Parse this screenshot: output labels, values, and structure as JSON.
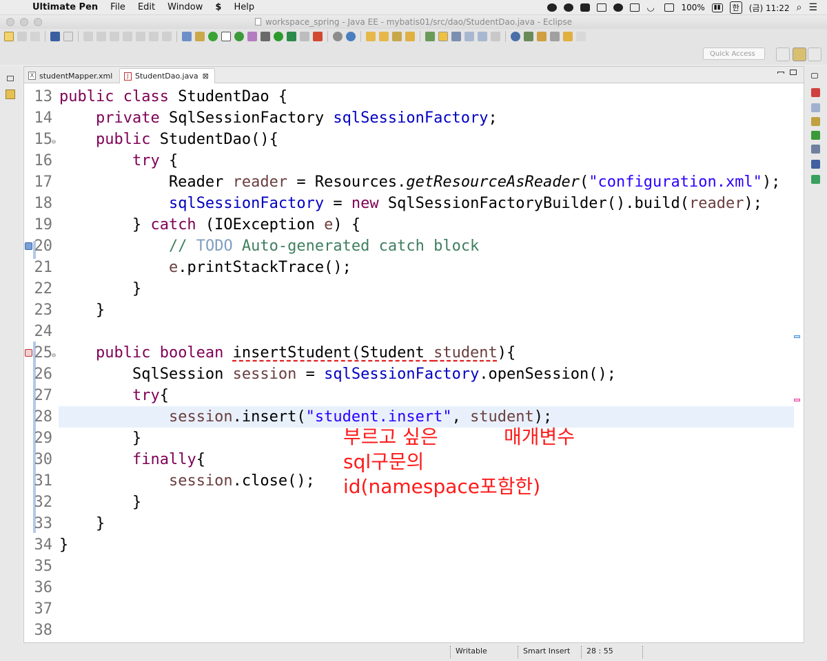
{
  "menubar": {
    "app_name": "Ultimate Pen",
    "items": [
      "File",
      "Edit",
      "Window",
      "Help"
    ],
    "battery": "100%",
    "ime": "한",
    "clock": "(금) 11:22"
  },
  "window": {
    "title": "workspace_spring - Java EE - mybatis01/src/dao/StudentDao.java - Eclipse"
  },
  "toolbar": {
    "quick_access_placeholder": "Quick Access"
  },
  "editor": {
    "tabs": [
      {
        "label": "studentMapper.xml",
        "icon": "xml-file-icon",
        "active": false
      },
      {
        "label": "StudentDao.java",
        "icon": "java-file-icon",
        "active": true
      }
    ],
    "current_line": 28,
    "lines": [
      {
        "n": "13",
        "html": "<span class=\"kw\">public class</span> StudentDao {"
      },
      {
        "n": "14",
        "html": "    <span class=\"kw\">private</span> SqlSessionFactory <span class=\"fld\">sqlSessionFactory</span>;"
      },
      {
        "n": "15",
        "fold": true,
        "html": "    <span class=\"kw\">public</span> StudentDao(){"
      },
      {
        "n": "16",
        "html": "        <span class=\"kw\">try</span> {"
      },
      {
        "n": "17",
        "html": "            Reader <span class=\"var\">reader</span> = Resources.<span class=\"ita\">getResourceAsReader</span>(<span class=\"str\">\"configuration.xml\"</span>);"
      },
      {
        "n": "18",
        "html": "            <span class=\"fld\">sqlSessionFactory</span> = <span class=\"kw\">new</span> SqlSessionFactoryBuilder().build(<span class=\"var\">reader</span>);"
      },
      {
        "n": "19",
        "html": "        } <span class=\"kw\">catch</span> (IOException <span class=\"var\">e</span>) {"
      },
      {
        "n": "20",
        "marker": "task",
        "html": "            <span class=\"cmt\">// </span><span class=\"todo\">TODO</span><span class=\"cmt\"> Auto-generated catch block</span>"
      },
      {
        "n": "21",
        "html": "            <span class=\"var\">e</span>.printStackTrace();"
      },
      {
        "n": "22",
        "html": "        }"
      },
      {
        "n": "23",
        "html": "    }"
      },
      {
        "n": "24",
        "html": ""
      },
      {
        "n": "25",
        "fold": true,
        "marker": "error",
        "html": "    <span class=\"kw\">public boolean</span> <span class=\"warn\">insertStudent(Student <span class=\"var\">student</span></span>){"
      },
      {
        "n": "26",
        "html": "        SqlSession <span class=\"var\">session</span> = <span class=\"fld\">sqlSessionFactory</span>.openSession();"
      },
      {
        "n": "27",
        "html": "        <span class=\"kw\">try</span>{"
      },
      {
        "n": "28",
        "html": "            <span class=\"var\">session</span>.insert(<span class=\"str\">\"student.insert\"</span>, <span class=\"var\">student</span>);"
      },
      {
        "n": "29",
        "html": "        }"
      },
      {
        "n": "30",
        "html": "        <span class=\"kw\">finally</span>{"
      },
      {
        "n": "31",
        "html": "            <span class=\"var\">session</span>.close();"
      },
      {
        "n": "32",
        "html": "        }"
      },
      {
        "n": "33",
        "html": "    }"
      },
      {
        "n": "34",
        "html": "}"
      },
      {
        "n": "35",
        "html": ""
      },
      {
        "n": "36",
        "html": ""
      },
      {
        "n": "37",
        "html": ""
      },
      {
        "n": "38",
        "html": ""
      }
    ]
  },
  "annotations": {
    "sql_id_note": [
      "부르고 싶은",
      "sql구문의",
      "id(namespace포함한)"
    ],
    "param_note": "매개변수"
  },
  "statusbar": {
    "mode": "Writable",
    "insert_mode": "Smart Insert",
    "position": "28 : 55"
  },
  "colors": {
    "keyword": "#7f0055",
    "field": "#0000c0",
    "string": "#2a00ff",
    "comment": "#3f7f5f",
    "annotation": "#ff1a1a",
    "current_line": "#e8f0fb"
  }
}
